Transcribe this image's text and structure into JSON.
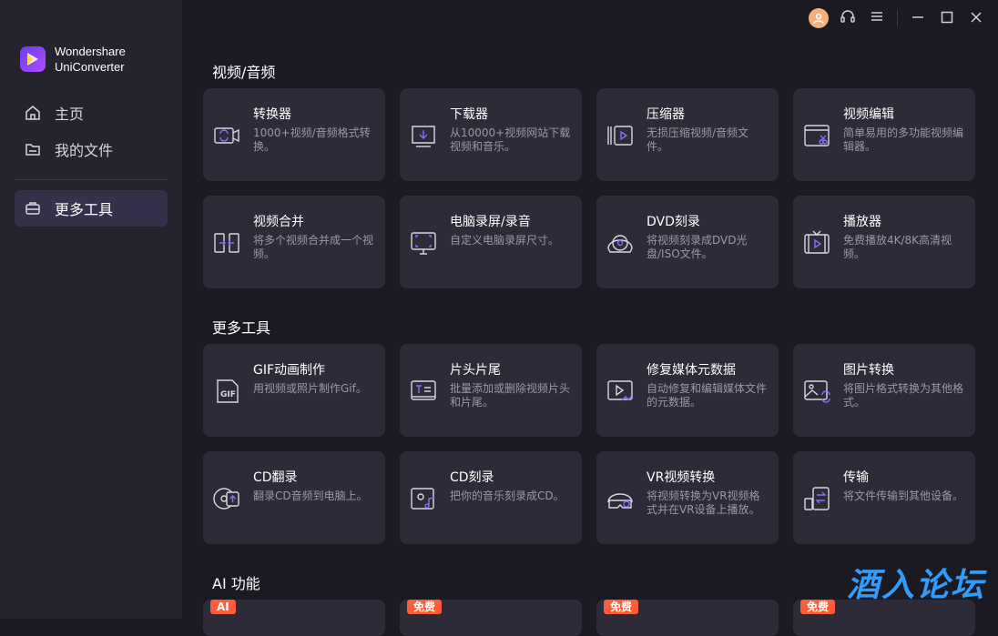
{
  "brand": {
    "line1": "Wondershare",
    "line2": "UniConverter"
  },
  "nav": [
    {
      "label": "主页",
      "icon": "home-icon"
    },
    {
      "label": "我的文件",
      "icon": "folder-icon"
    },
    {
      "label": "更多工具",
      "icon": "toolbox-icon",
      "active": true
    }
  ],
  "sections": {
    "video_audio": "视频/音频",
    "more_tools": "更多工具",
    "ai": "AI 功能"
  },
  "cards_video": [
    {
      "title": "转换器",
      "desc": "1000+视频/音频格式转换。",
      "icon": "converter-icon"
    },
    {
      "title": "下载器",
      "desc": "从10000+视频网站下载视频和音乐。",
      "icon": "download-icon"
    },
    {
      "title": "压缩器",
      "desc": "无损压缩视频/音频文件。",
      "icon": "compress-icon"
    },
    {
      "title": "视频编辑",
      "desc": "简单易用的多功能视频编辑器。",
      "icon": "video-edit-icon"
    },
    {
      "title": "视频合并",
      "desc": "将多个视频合并成一个视频。",
      "icon": "merge-icon"
    },
    {
      "title": "电脑录屏/录音",
      "desc": "自定义电脑录屏尺寸。",
      "icon": "screen-record-icon"
    },
    {
      "title": "DVD刻录",
      "desc": "将视频刻录成DVD光盘/ISO文件。",
      "icon": "dvd-burn-icon"
    },
    {
      "title": "播放器",
      "desc": "免费播放4K/8K高清视频。",
      "icon": "player-icon"
    }
  ],
  "cards_tools": [
    {
      "title": "GIF动画制作",
      "desc": "用视频或照片制作Gif。",
      "icon": "gif-icon"
    },
    {
      "title": "片头片尾",
      "desc": "批量添加或删除视频片头和片尾。",
      "icon": "intro-outro-icon"
    },
    {
      "title": "修复媒体元数据",
      "desc": "自动修复和编辑媒体文件的元数据。",
      "icon": "metadata-icon"
    },
    {
      "title": "图片转换",
      "desc": "将图片格式转换为其他格式。",
      "icon": "image-convert-icon"
    },
    {
      "title": "CD翻录",
      "desc": "翻录CD音频到电脑上。",
      "icon": "cd-rip-icon"
    },
    {
      "title": "CD刻录",
      "desc": "把你的音乐刻录成CD。",
      "icon": "cd-burn-icon"
    },
    {
      "title": "VR视频转换",
      "desc": "将视频转换为VR视频格式并在VR设备上播放。",
      "icon": "vr-icon"
    },
    {
      "title": "传输",
      "desc": "将文件传输到其他设备。",
      "icon": "transfer-icon"
    }
  ],
  "ai_badges": [
    "AI",
    "免费",
    "免费",
    "免费"
  ],
  "watermark": "酒入论坛",
  "colors": {
    "accent": "#7b61ff",
    "badge_ai": "#ff5c39",
    "badge_free": "#ff5c39"
  }
}
